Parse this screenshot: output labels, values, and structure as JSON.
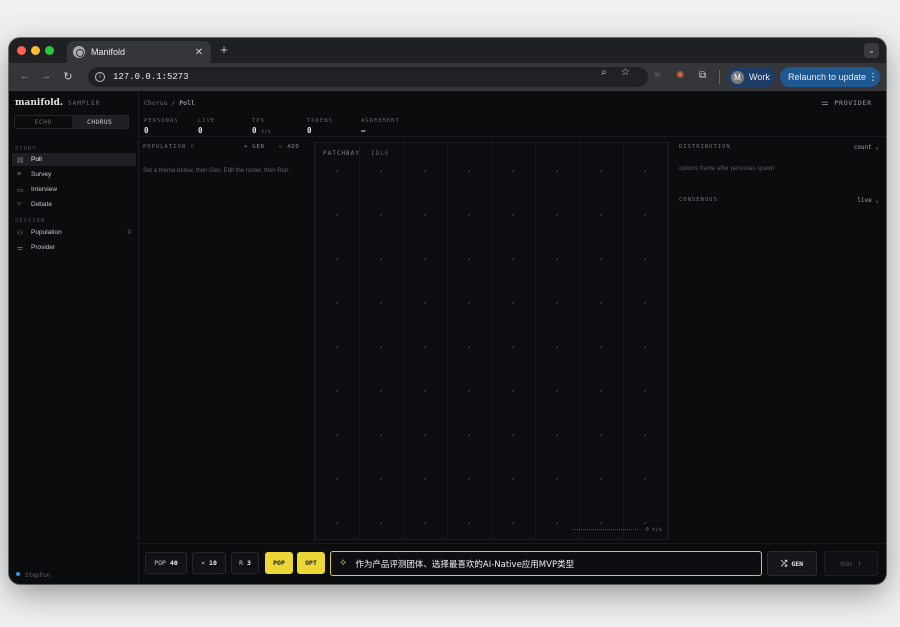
{
  "browser": {
    "tab_title": "Manifold",
    "url": "127.0.0.1:5273",
    "profile_initial": "M",
    "profile_label": "Work",
    "relaunch_label": "Relaunch to update"
  },
  "app": {
    "brand": "manifold.",
    "brand_sub": "SAMPLER",
    "modes": [
      "ECHO",
      "CHORUS"
    ],
    "active_mode": "CHORUS",
    "sections": {
      "study_label": "STUDY",
      "study_items": [
        {
          "label": "Poll",
          "icon": "poll-icon",
          "active": true
        },
        {
          "label": "Survey",
          "icon": "survey-icon",
          "active": false
        },
        {
          "label": "Interview",
          "icon": "interview-icon",
          "active": false
        },
        {
          "label": "Debate",
          "icon": "debate-icon",
          "active": false
        }
      ],
      "session_label": "SESSION",
      "session_items": [
        {
          "label": "Population",
          "icon": "population-icon",
          "count": "0"
        },
        {
          "label": "Provider",
          "icon": "provider-icon",
          "count": ""
        }
      ]
    },
    "footer": "StepFun"
  },
  "header": {
    "crumb_root": "Chorus",
    "crumb_sep": "/",
    "crumb_current": "Poll",
    "provider_label": "PROVIDER"
  },
  "stats": [
    {
      "key": "PERSONAS",
      "value": "0",
      "unit": ""
    },
    {
      "key": "LIVE",
      "value": "0",
      "unit": ""
    },
    {
      "key": "TPS",
      "value": "0",
      "unit": "t/s"
    },
    {
      "key": "TOKENS",
      "value": "0",
      "unit": ""
    },
    {
      "key": "AGREEMENT",
      "value": "—",
      "unit": ""
    }
  ],
  "population": {
    "title": "POPULATION",
    "count": "0",
    "gen_label": "+ GEN",
    "add_label": "ADD",
    "hint": "Set a theme below, then Gen. Edit the roster, then Run."
  },
  "canvas": {
    "label": "PATCHBAY",
    "status": "IDLE",
    "rate": "0 t/s"
  },
  "distribution": {
    "title": "DISTRIBUTION",
    "select": "count",
    "hint": "options frame after personas spawn"
  },
  "consensus": {
    "title": "CONSENSUS",
    "select": "live"
  },
  "controls": {
    "pop": {
      "label": "POP",
      "value": "40"
    },
    "x": {
      "label": "×",
      "value": "10"
    },
    "r": {
      "label": "R",
      "value": "3"
    },
    "pop_toggle": "POP",
    "opt_toggle": "OPT",
    "prompt_value": "作为产品评测团体、选择最喜欢的AI-Native应用MVP类型",
    "gen_label": "GEN",
    "run_label": "RUN"
  },
  "colors": {
    "accent_yellow": "#ecd736",
    "relaunch_blue": "#1e5a91",
    "background": "#0b0c0e"
  }
}
